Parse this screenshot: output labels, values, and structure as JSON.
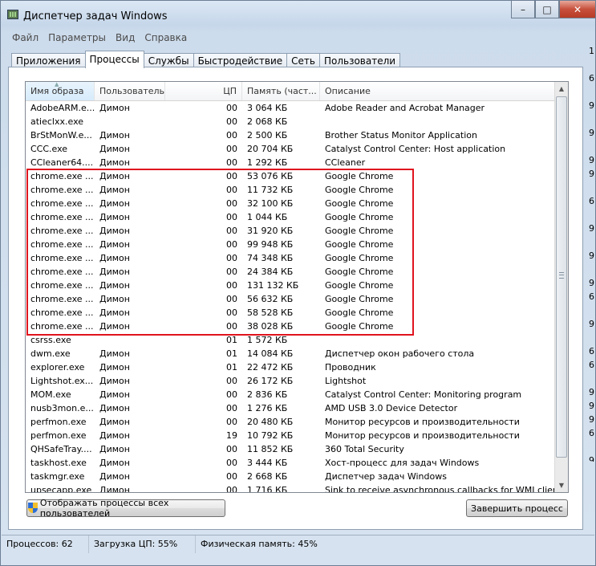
{
  "window": {
    "title": "Диспетчер задач Windows",
    "controls": {
      "minimize": "–",
      "maximize": "□",
      "close": "✕"
    }
  },
  "menu": [
    "Файл",
    "Параметры",
    "Вид",
    "Справка"
  ],
  "tabs": [
    {
      "label": "Приложения",
      "active": false
    },
    {
      "label": "Процессы",
      "active": true
    },
    {
      "label": "Службы",
      "active": false
    },
    {
      "label": "Быстродействие",
      "active": false
    },
    {
      "label": "Сеть",
      "active": false
    },
    {
      "label": "Пользователи",
      "active": false
    }
  ],
  "table": {
    "columns": [
      "Имя образа",
      "Пользователь",
      "ЦП",
      "Память (част...",
      "Описание"
    ],
    "rows": [
      [
        "AdobeARM.e...",
        "Димон",
        "00",
        "3 064 КБ",
        "Adobe Reader and Acrobat Manager"
      ],
      [
        "atieclxx.exe",
        "",
        "00",
        "2 068 КБ",
        ""
      ],
      [
        "BrStMonW.e...",
        "Димон",
        "00",
        "2 500 КБ",
        "Brother Status Monitor Application"
      ],
      [
        "CCC.exe",
        "Димон",
        "00",
        "20 704 КБ",
        "Catalyst Control Center: Host application"
      ],
      [
        "CCleaner64....",
        "Димон",
        "00",
        "1 292 КБ",
        "CCleaner"
      ],
      [
        "chrome.exe ...",
        "Димон",
        "00",
        "53 076 КБ",
        "Google Chrome"
      ],
      [
        "chrome.exe ...",
        "Димон",
        "00",
        "11 732 КБ",
        "Google Chrome"
      ],
      [
        "chrome.exe ...",
        "Димон",
        "00",
        "32 100 КБ",
        "Google Chrome"
      ],
      [
        "chrome.exe ...",
        "Димон",
        "00",
        "1 044 КБ",
        "Google Chrome"
      ],
      [
        "chrome.exe ...",
        "Димон",
        "00",
        "31 920 КБ",
        "Google Chrome"
      ],
      [
        "chrome.exe ...",
        "Димон",
        "00",
        "99 948 КБ",
        "Google Chrome"
      ],
      [
        "chrome.exe ...",
        "Димон",
        "00",
        "74 348 КБ",
        "Google Chrome"
      ],
      [
        "chrome.exe ...",
        "Димон",
        "00",
        "24 384 КБ",
        "Google Chrome"
      ],
      [
        "chrome.exe ...",
        "Димон",
        "00",
        "131 132 КБ",
        "Google Chrome"
      ],
      [
        "chrome.exe ...",
        "Димон",
        "00",
        "56 632 КБ",
        "Google Chrome"
      ],
      [
        "chrome.exe ...",
        "Димон",
        "00",
        "58 528 КБ",
        "Google Chrome"
      ],
      [
        "chrome.exe ...",
        "Димон",
        "00",
        "38 028 КБ",
        "Google Chrome"
      ],
      [
        "csrss.exe",
        "",
        "01",
        "1 572 КБ",
        ""
      ],
      [
        "dwm.exe",
        "Димон",
        "01",
        "14 084 КБ",
        "Диспетчер окон рабочего стола"
      ],
      [
        "explorer.exe",
        "Димон",
        "01",
        "22 472 КБ",
        "Проводник"
      ],
      [
        "Lightshot.ex...",
        "Димон",
        "00",
        "26 172 КБ",
        "Lightshot"
      ],
      [
        "MOM.exe",
        "Димон",
        "00",
        "2 836 КБ",
        "Catalyst Control Center: Monitoring program"
      ],
      [
        "nusb3mon.e...",
        "Димон",
        "00",
        "1 276 КБ",
        "AMD USB 3.0 Device Detector"
      ],
      [
        "perfmon.exe",
        "Димон",
        "00",
        "20 480 КБ",
        "Монитор ресурсов и производительности"
      ],
      [
        "perfmon.exe",
        "Димон",
        "19",
        "10 792 КБ",
        "Монитор ресурсов и производительности"
      ],
      [
        "QHSafeTray....",
        "Димон",
        "00",
        "11 852 КБ",
        "360 Total Security"
      ],
      [
        "taskhost.exe",
        "Димон",
        "00",
        "3 444 КБ",
        "Хост-процесс для задач Windows"
      ],
      [
        "taskmgr.exe",
        "Димон",
        "00",
        "2 668 КБ",
        "Диспетчер задач Windows"
      ],
      [
        "upsecapp.exe",
        "Димон",
        "00",
        "1 716 КБ",
        "Sink to receive asynchronous callbacks for WMI clien..."
      ]
    ]
  },
  "buttons": {
    "show_all": "Отображать процессы всех пользователей",
    "end_process": "Завершить процесс"
  },
  "status": {
    "processes": "Процессов: 62",
    "cpu": "Загрузка ЦП: 55%",
    "memory": "Физическая память: 45%"
  },
  "background_strip": [
    "1",
    "",
    "6",
    "",
    "9",
    "",
    "9",
    "",
    "9",
    "9",
    "",
    "6",
    "",
    "9",
    "",
    "9",
    "",
    "9",
    "6",
    "",
    "9",
    "",
    "6",
    "6",
    "",
    "9",
    "9",
    "9",
    "6",
    "",
    "9"
  ]
}
